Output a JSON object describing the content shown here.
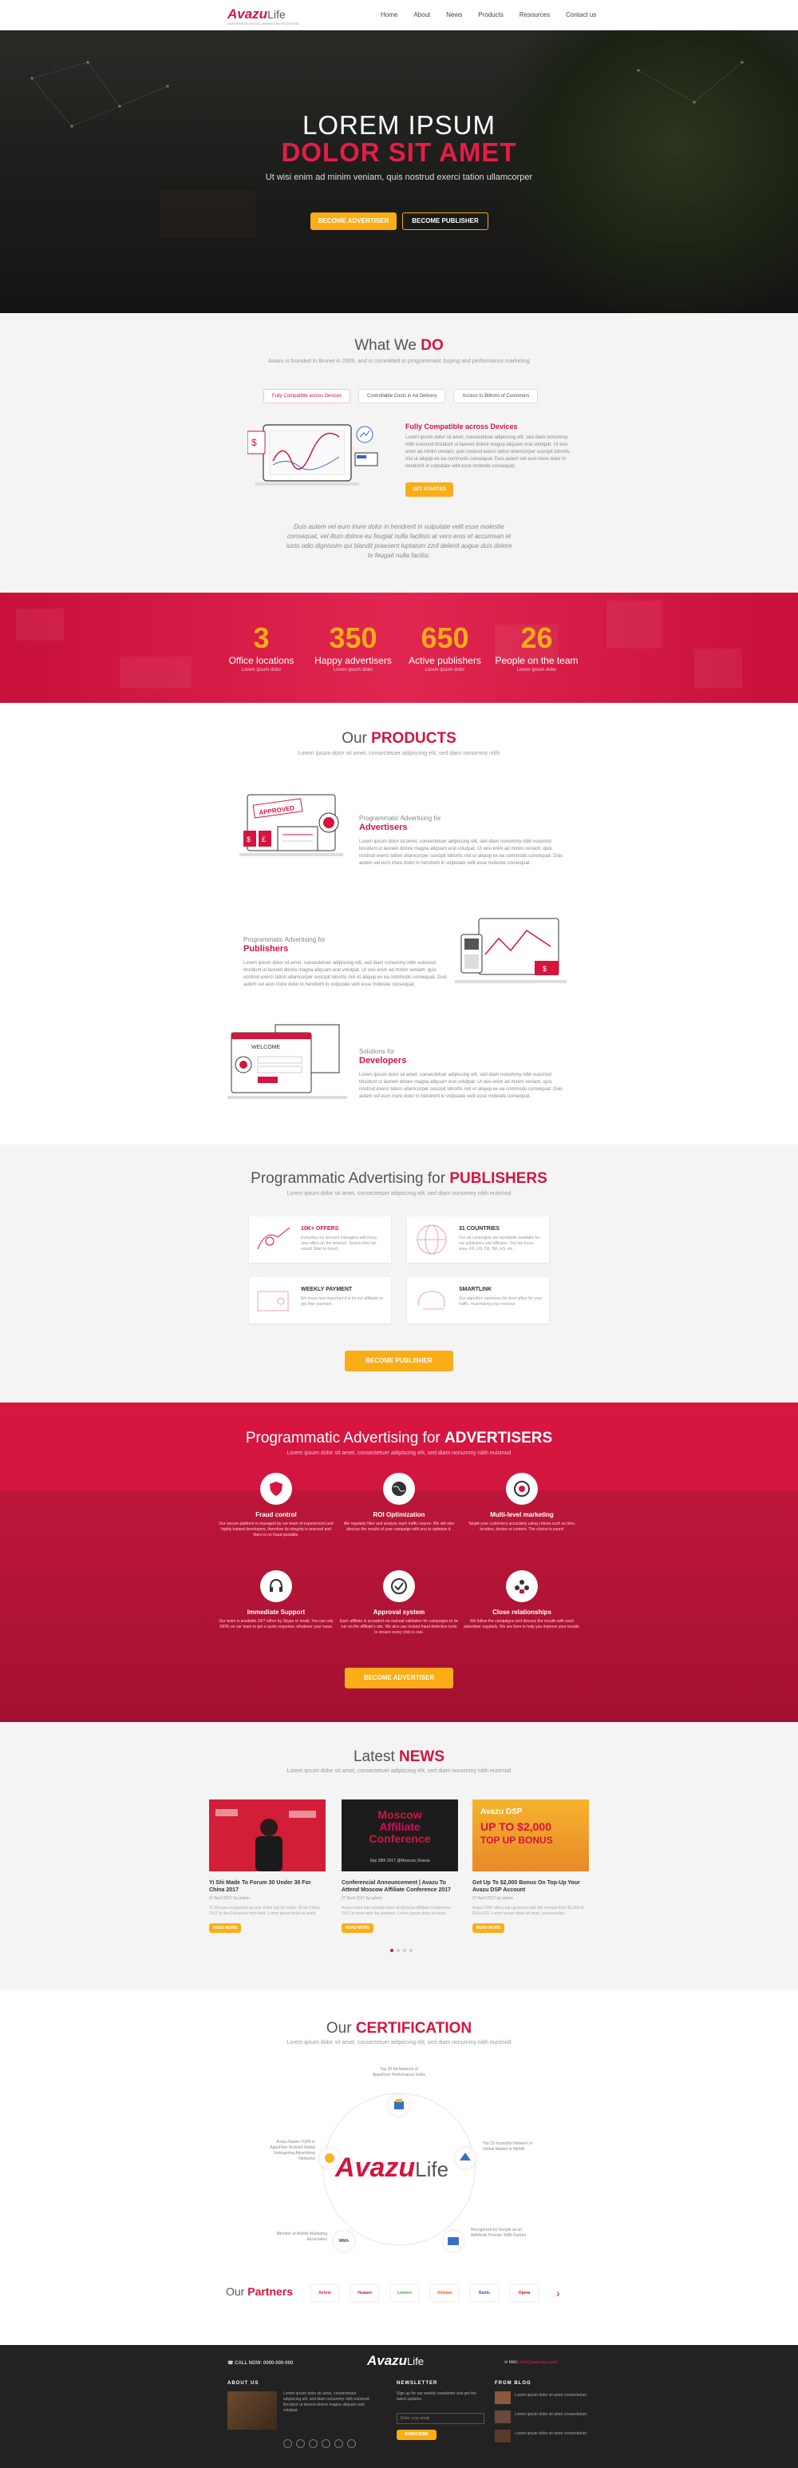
{
  "header": {
    "logo": "Avazu",
    "logo_suffix": "Life",
    "tagline": "ENTERPRISE DIGITAL MARKETING PLATFORM",
    "nav": [
      "Home",
      "About",
      "News",
      "Products",
      "Resources",
      "Contact us"
    ]
  },
  "hero": {
    "line1": "LOREM IPSUM",
    "line2": "DOLOR SIT AMET",
    "subtitle": "Ut wisi enim ad minim veniam, quis nostrud exerci tation ullamcorper",
    "btn_primary": "BECOME ADVERTISER",
    "btn_secondary": "BECOME PUBLISHER"
  },
  "what_we_do": {
    "title_a": "What We ",
    "title_b": "DO",
    "subtitle": "Avazu is founded in Brunei in 2009, and is committed to programmatic buying and performance marketing",
    "tabs": [
      "Fully Compatible across Devices",
      "Controllable Costs in Ad Delivery",
      "Access to Billions of Customers"
    ],
    "feature_title": "Fully Compatible across Devices",
    "feature_desc": "Lorem ipsum dolor sit amet, consectetuer adipiscing elit, sed diam nonummy nibh euismod tincidunt ut laoreet dolore magna aliquam erat volutpat. Ut wisi enim ad minim veniam, quis nostrud exerci tation ullamcorper suscipit lobortis nisl ut aliquip ex ea commodo consequat. Duis autem vel eum iriure dolor in hendrerit in vulputate velit esse molestie consequat.",
    "get_started": "GET STARTED",
    "quote": "Duis autem vel eum iriure dolor in hendrerit in vulputate velit esse molestie consequat, vel illum dolore eu feugiat nulla facilisis at vero eros et accumsan et iusto odio dignissim qui blandit praesent luptatum zzril delenit augue duis dolore te feugait nulla facilisi."
  },
  "stats": [
    {
      "num": "3",
      "label": "Office locations",
      "sub": "Lorem ipsum dolor"
    },
    {
      "num": "350",
      "label": "Happy advertisers",
      "sub": "Lorem ipsum dolor"
    },
    {
      "num": "650",
      "label": "Active publishers",
      "sub": "Lorem ipsum dolor"
    },
    {
      "num": "26",
      "label": "People on the team",
      "sub": "Lorem ipsum dolor"
    }
  ],
  "products": {
    "title_a": "Our ",
    "title_b": "PRODUCTS",
    "subtitle": "Lorem ipsum dolor sit amet, consectetuer adipiscing elit, sed diam nonummy nibh",
    "items": [
      {
        "pre": "Programmatic Advertising for",
        "name": "Advertisers",
        "desc": "Lorem ipsum dolor sit amet, consectetuer adipiscing elit, sed diam nonummy nibh euismod tincidunt ut laoreet dolore magna aliquam erat volutpat. Ut wisi enim ad minim veniam, quis nostrud exerci tation ullamcorper suscipit lobortis nisl ut aliquip ex ea commodo consequat. Duis autem vel eum iriure dolor in hendrerit in vulputate velit esse molestie consequat."
      },
      {
        "pre": "Programmatic Advertising for",
        "name": "Publishers",
        "desc": "Lorem ipsum dolor sit amet, consectetuer adipiscing elit, sed diam nonummy nibh euismod tincidunt ut laoreet dolore magna aliquam erat volutpat. Ut wisi enim ad minim veniam, quis nostrud exerci tation ullamcorper suscipit lobortis nisl ut aliquip ex ea commodo consequat. Duis autem vel eum iriure dolor in hendrerit in vulputate velit esse molestie consequat."
      },
      {
        "pre": "Solutions for",
        "name": "Developers",
        "desc": "Lorem ipsum dolor sit amet, consectetuer adipiscing elit, sed diam nonummy nibh euismod tincidunt ut laoreet dolore magna aliquam erat volutpat. Ut wisi enim ad minim veniam, quis nostrud exerci tation ullamcorper suscipit lobortis nisl ut aliquip ex ea commodo consequat. Duis autem vel eum iriure dolor in hendrerit in vulputate velit esse molestie consequat."
      }
    ],
    "approved_label": "APPROVED",
    "welcome_label": "WELCOME"
  },
  "publishers": {
    "title_a": "Programmatic Advertising for ",
    "title_b": "PUBLISHERS",
    "subtitle": "Lorem ipsum dolor sit amet, consectetuer adipiscing elit, sed diam nonummy nibh euismod",
    "cards": [
      {
        "title": "10K+ OFFERS",
        "desc": "Everyday our account managers add many new offers on the network. Search then we would! Start to found"
      },
      {
        "title": "31 COUNTRIES",
        "desc": "Our ad campaigns are worldwide available for our publishers and affiliates. Our top focus area: FR, US, DE, BR, ES, etc."
      },
      {
        "title": "WEEKLY PAYMENT",
        "desc": "We know how important it is for our affiliates to get their payment."
      },
      {
        "title": "SMARTLINK",
        "desc": "Our algorithm optimizes the best offers for your traffic, maximizing your revenue"
      }
    ],
    "button": "BECOME PUBLISHER"
  },
  "advertisers": {
    "title_a": "Programmatic Advertising for ",
    "title_b": "ADVERTISERS",
    "subtitle": "Lorem ipsum dolor sit amet, consectetuer adipiscing elit, sed diam nonummy nibh euismod",
    "features": [
      {
        "title": "Fraud control",
        "desc": "Our secure platform is managed by our team of experienced and highly trained developers, therefore its integrity is ensured and there is no fraud possible."
      },
      {
        "title": "ROI Optimization",
        "desc": "We regularly filter and analyze each traffic source. We will also discuss the results of your campaign with you to optimize it."
      },
      {
        "title": "Multi-level marketing",
        "desc": "Target your customers accurately using criteria such as time, location, device or content. The choice is yours!"
      },
      {
        "title": "Immediate Support",
        "desc": "Our team is available 24/7 either by Skype or email. You can rely 100% on our team to get a quick response, whatever your issue."
      },
      {
        "title": "Approval system",
        "desc": "Each affiliate is accepted via manual validation for campaigns to be run on the affiliate's site. We also use instant fraud detection tools to ensure every click is real."
      },
      {
        "title": "Close relationships",
        "desc": "We follow the campaigns and discuss the results with each advertiser regularly. We are here to help you improve your results."
      }
    ],
    "button": "BECOME ADVERTISER"
  },
  "news": {
    "title_a": "Latest ",
    "title_b": "NEWS",
    "subtitle": "Lorem ipsum dolor sit amet, consectetuer adipiscing elit, sed diam nonummy nibh euismod",
    "items": [
      {
        "title": "Yi Shi Made To Forum 30 Under 30 For China 2017",
        "meta": "27 April 2017  by admin",
        "desc": "Yi Shi was recognized as one of the top 30 Under 30 for China 2017 in the Enterprise tech field. Lorem ipsum dolor sit amet."
      },
      {
        "title": "Conferencial Announcement | Avazu To Attend Moscow Affiliate Conference 2017",
        "meta": "27 April 2017  by admin",
        "desc": "Avazu team has recently been at Moscow Affiliate Conference 2017 to meet with the partners. Lorem ipsum dolor sit amet."
      },
      {
        "title": "Get Up To $2,000 Bonus On Top-Up Your Avazu DSP Account",
        "meta": "27 April 2017  by admin",
        "desc": "Avazu DSP offers top-up bonus with the amount from $2,000 to $100,000. Lorem ipsum dolor sit amet, consectetuer."
      }
    ],
    "img2_line1": "Moscow",
    "img2_line2": "Affiliate",
    "img2_line3": "Conference",
    "img2_date": "Sep 28th 2017 @Moscow, Russia",
    "img3_line1": "Avazu DSP",
    "img3_line2": "UP TO $2,000",
    "img3_line3": "TOP UP BONUS",
    "read_more": "Read More"
  },
  "certification": {
    "title_a": "Our ",
    "title_b": "CERTIFICATION",
    "subtitle": "Lorem ipsum dolor sit amet, consectetuer adipiscing elit, sed diam nonummy nibh euismod",
    "logo": "Avazu",
    "logo_suffix": "Life",
    "labels": [
      "Top 20 Ad Network of AppsFlyer Performance Index",
      "Top 15 Impactful Network of Global Market in MENA",
      "Recognized by Google as an AdWords Premier SMB Partner",
      "Member of Mobile Marketing Association",
      "Avazu Ranks TOP5 in AppsFlyer Android Global Retargeting Advertising Networks"
    ],
    "badge_mma": "MMA",
    "partners_a": "Our ",
    "partners_b": "Partners",
    "partners": [
      "Airbnb",
      "Huawei",
      "Lenovo",
      "Alibaba",
      "Baidu",
      "Opera"
    ]
  },
  "footer": {
    "call": "CALL NOW: 0000-000-000",
    "logo": "Avazu",
    "logo_suffix": "Life",
    "mail_label": "MAIL:",
    "mail": "info@avazuinc.com",
    "about_h": "ABOUT US",
    "about": "Lorem ipsum dolor sit amet, consectetuer adipiscing elit, sed diam nonummy nibh euismod tincidunt ut laoreet dolore magna aliquam erat volutpat.",
    "news_h": "NEWSLETTER",
    "news_txt": "Sign up for our weekly newsletter and get the latest updates",
    "email_ph": "Enter your email",
    "subscribe": "SUBSCRIBE",
    "blog_h": "FROM BLOG",
    "blog": [
      "Lorem ipsum dolor sit amet consectetuer",
      "Lorem ipsum dolor sit amet consectetuer",
      "Lorem ipsum dolor sit amet consectetuer"
    ]
  }
}
